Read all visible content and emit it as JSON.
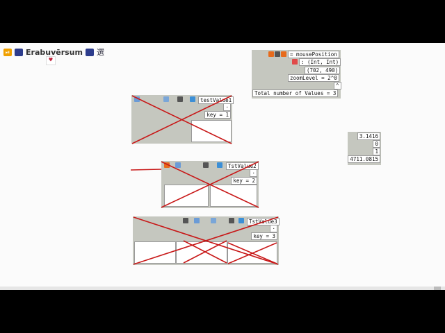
{
  "app": {
    "title": "Erabuvērsum",
    "kanji": "選",
    "heart": "♥"
  },
  "mouse_panel": {
    "header": "= mousePosition",
    "type_sig": ": (Int, Int)",
    "position": "(702, 490)",
    "zoom": "zoomLevel = 2^0",
    "total": "Total number of Values = 3"
  },
  "values_list": [
    "3.1416",
    "0",
    "1",
    "4711.0815"
  ],
  "nodes": [
    {
      "name": "testValue1",
      "key": "key = 1"
    },
    {
      "name": "TstValue2",
      "key": "key = 2"
    },
    {
      "name": "TstValue3",
      "key": "key = 3"
    }
  ],
  "colors": {
    "node_bg": "#c5c7bf",
    "cross": "#c81818",
    "accent_blue": "#2d3c8c",
    "accent_orange": "#f0a000"
  },
  "icons": [
    "play-pause-icon",
    "erabuversum-logo-icon",
    "flame-icon",
    "trash-icon",
    "magnifier-icon",
    "bucket-icon",
    "globe-icon",
    "heart-icon"
  ]
}
